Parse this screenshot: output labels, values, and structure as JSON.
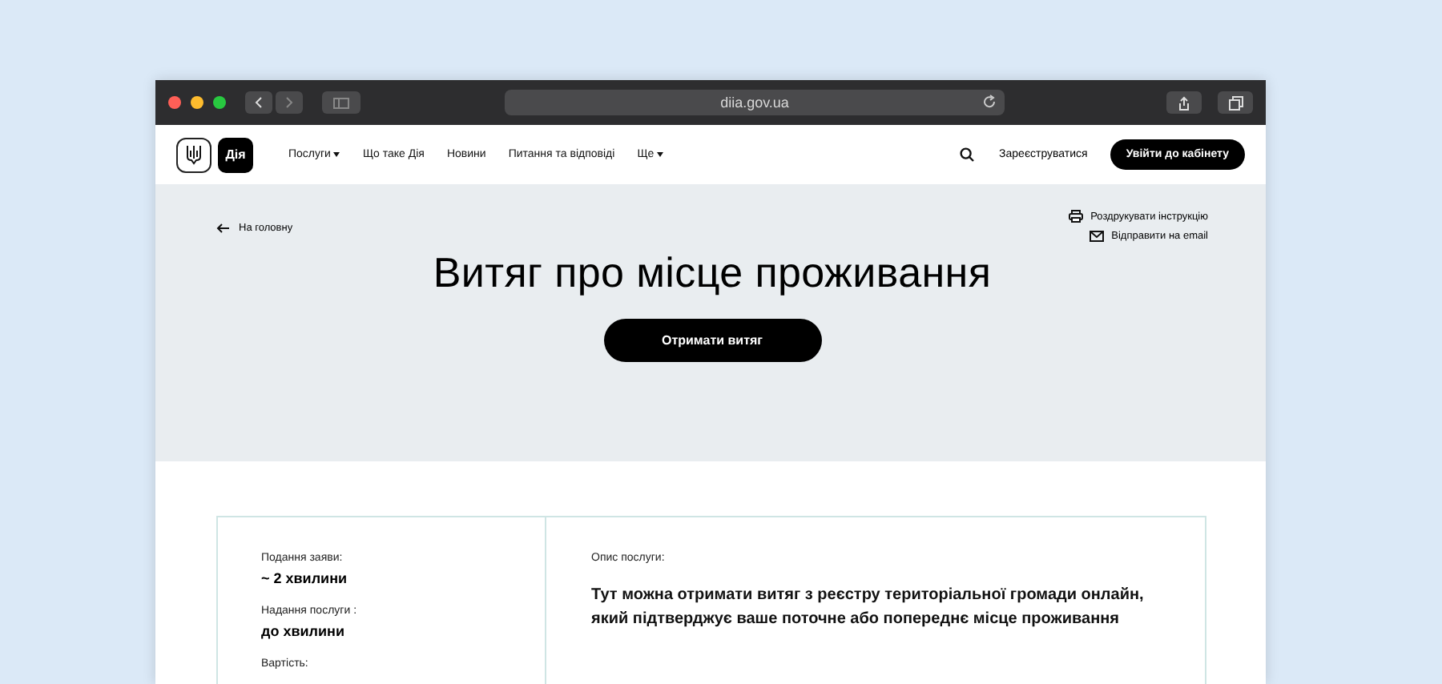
{
  "browser": {
    "url": "diia.gov.ua"
  },
  "nav": {
    "logo": "Дія",
    "items": [
      {
        "label": "Послуги",
        "dropdown": true
      },
      {
        "label": "Що таке Дія",
        "dropdown": false
      },
      {
        "label": "Новини",
        "dropdown": false
      },
      {
        "label": "Питання та відповіді",
        "dropdown": false
      },
      {
        "label": "Ще",
        "dropdown": true
      }
    ],
    "register": "Зареєструватися",
    "login": "Увійти до кабінету"
  },
  "hero": {
    "back": "На головну",
    "actions": [
      {
        "kind": "print",
        "label": "Роздрукувати інструкцію"
      },
      {
        "kind": "email",
        "label": "Відправити на email"
      }
    ],
    "title": "Витяг про місце проживання",
    "button": "Отримати витяг"
  },
  "info": {
    "facts": [
      {
        "label": "Подання заяви:",
        "value": "~ 2 хвилини"
      },
      {
        "label": "Надання послуги :",
        "value": "до хвилини"
      },
      {
        "label": "Вартість:"
      }
    ],
    "description_label": "Опис послуги:",
    "description": "Тут можна отримати витяг з реєстру територіальної громади онлайн, який підтверджує ваше поточне або попереднє місце проживання"
  }
}
